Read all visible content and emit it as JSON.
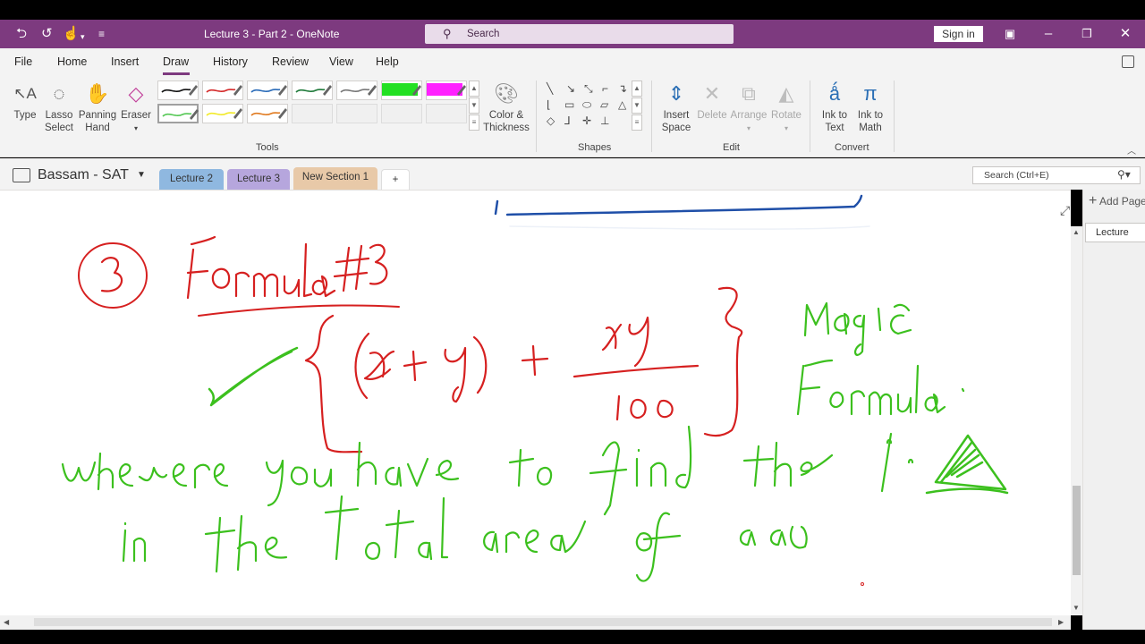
{
  "app": {
    "title": "Lecture 3 - Part 2  -  OneNote",
    "search_placeholder": "Search",
    "sign_in": "Sign in",
    "accent": "#7d3a7f"
  },
  "menu": [
    "File",
    "Home",
    "Insert",
    "Draw",
    "History",
    "Review",
    "View",
    "Help"
  ],
  "active_menu": "Draw",
  "ribbon": {
    "tools": {
      "type": "Type",
      "lasso_1": "Lasso",
      "lasso_2": "Select",
      "pan_1": "Panning",
      "pan_2": "Hand",
      "eraser": "Eraser",
      "color_1": "Color &",
      "color_2": "Thickness",
      "group": "Tools"
    },
    "pens_row1": [
      "#111111",
      "#d42a2a",
      "#2a6bb8",
      "#1f7a3a",
      "#777777",
      "#22e022",
      "#ff20ff"
    ],
    "pens_row2": [
      "#55c855",
      "#f2ea2a",
      "#e07a20"
    ],
    "shapes_group": "Shapes",
    "edit": {
      "insert_1": "Insert",
      "insert_2": "Space",
      "delete": "Delete",
      "arrange": "Arrange",
      "rotate": "Rotate",
      "group": "Edit"
    },
    "convert": {
      "ink_text_1": "Ink to",
      "ink_text_2": "Text",
      "ink_math_1": "Ink to",
      "ink_math_2": "Math",
      "group": "Convert"
    }
  },
  "notebook": {
    "name": "Bassam - SAT",
    "sections": [
      {
        "label": "Lecture 2",
        "color": "#8fb8e0"
      },
      {
        "label": "Lecture 3",
        "color": "#b6a6dd"
      },
      {
        "label": "New Section 1",
        "color": "#e8c9a8"
      }
    ],
    "add_section": "+",
    "page_search": "Search (Ctrl+E)"
  },
  "pages_panel": {
    "add_page": "Add Page",
    "pages": [
      "Lecture"
    ]
  },
  "ink": {
    "red_color": "#d62020",
    "green_color": "#3cc01e",
    "blue_color": "#1f4fa8",
    "heading": "③ Formula #3",
    "formula": "{ (x + y) + xy / 100 }",
    "note_1": "Magic Formula.",
    "note_2": "wherever you have to find the % Δ in the total area of a ..."
  }
}
